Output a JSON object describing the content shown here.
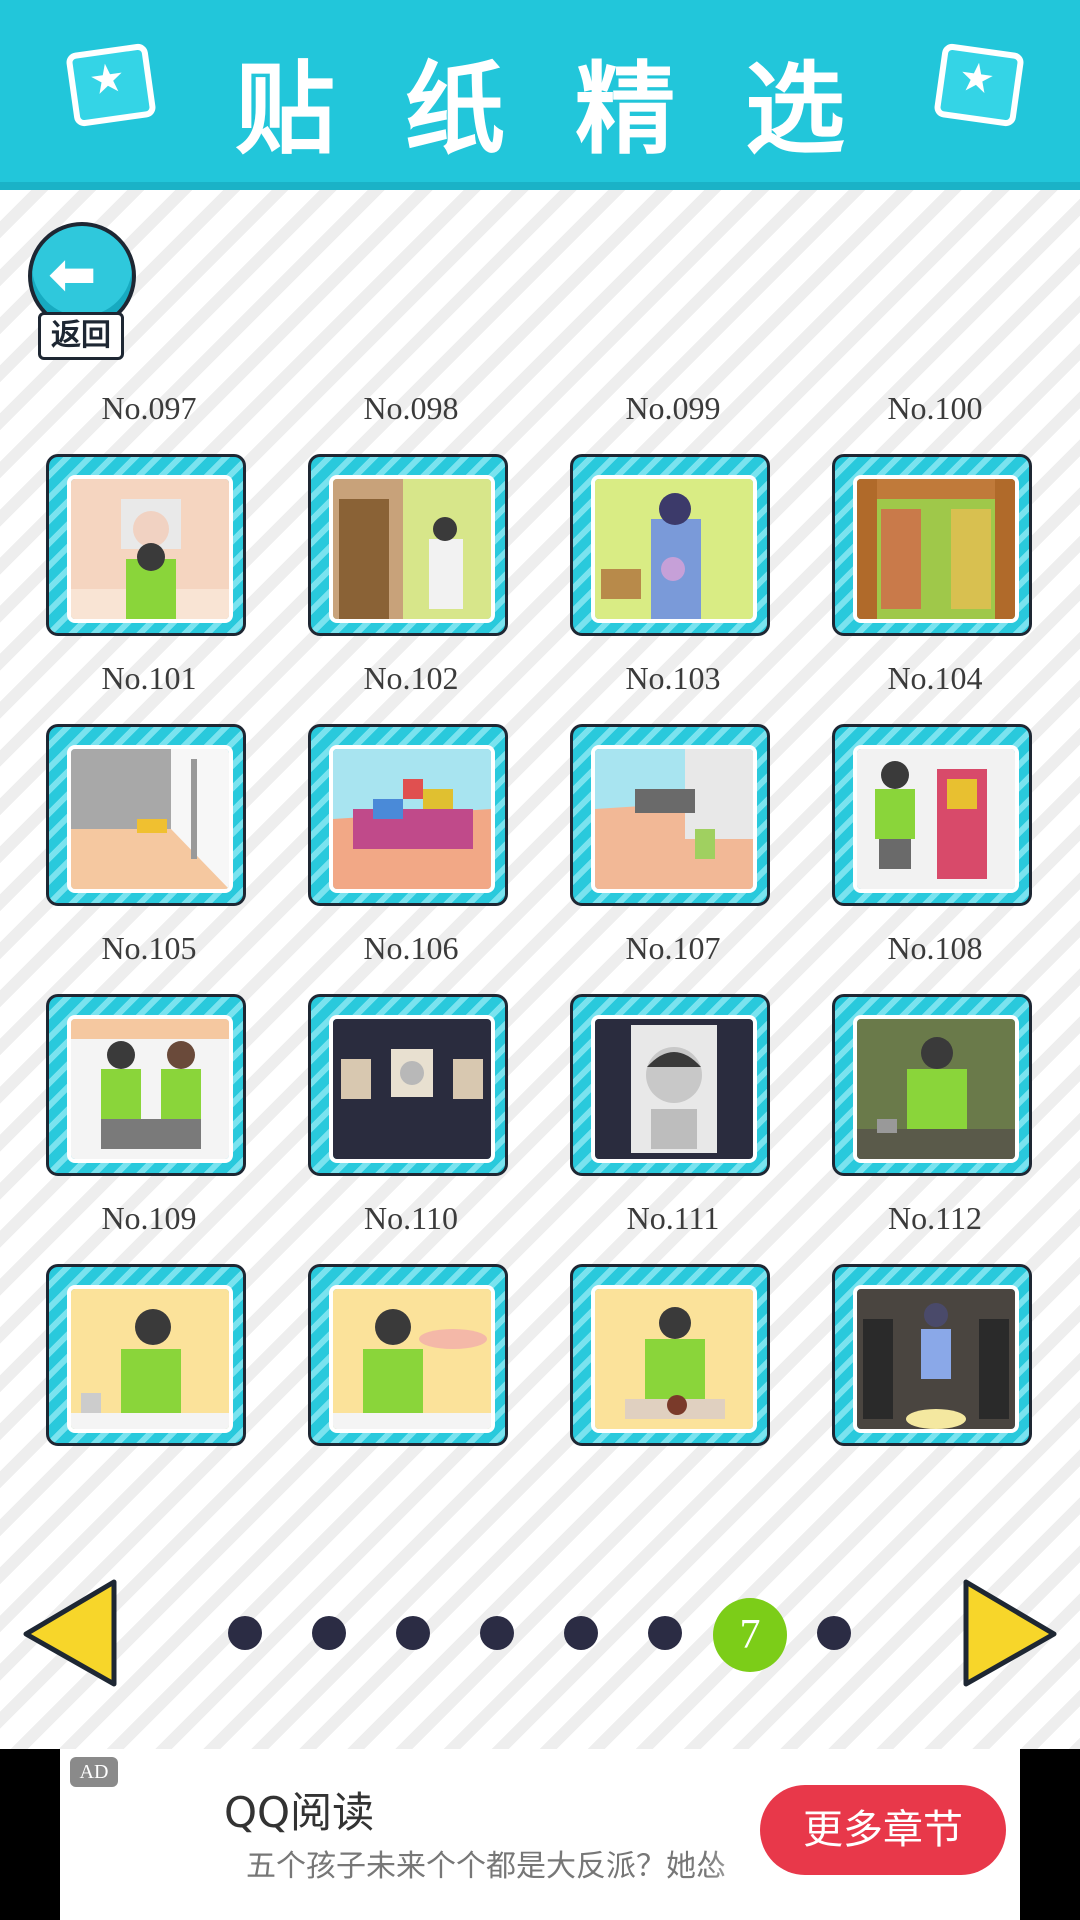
{
  "header": {
    "title": "贴纸精选",
    "left_icon": "sticker-star-icon",
    "right_icon": "sticker-star-icon"
  },
  "back": {
    "label": "返回",
    "icon": "back-arrow-icon"
  },
  "stickers": [
    {
      "label": "No.097"
    },
    {
      "label": "No.098"
    },
    {
      "label": "No.099"
    },
    {
      "label": "No.100"
    },
    {
      "label": "No.101"
    },
    {
      "label": "No.102"
    },
    {
      "label": "No.103"
    },
    {
      "label": "No.104"
    },
    {
      "label": "No.105"
    },
    {
      "label": "No.106"
    },
    {
      "label": "No.107"
    },
    {
      "label": "No.108"
    },
    {
      "label": "No.109"
    },
    {
      "label": "No.110"
    },
    {
      "label": "No.111"
    },
    {
      "label": "No.112"
    }
  ],
  "pager": {
    "current_page": "7",
    "total_pages": 8,
    "prev_icon": "triangle-left-icon",
    "next_icon": "triangle-right-icon"
  },
  "ad": {
    "tag": "AD",
    "title": "QQ阅读",
    "description": "五个孩子未来个个都是大反派？她怂",
    "button": "更多章节"
  },
  "colors": {
    "header": "#22c6da",
    "frame": "#29c9dc",
    "active_dot": "#7ccd18",
    "dot": "#2b2c44",
    "arrow": "#f7d62a",
    "ad_button": "#e8384a"
  }
}
